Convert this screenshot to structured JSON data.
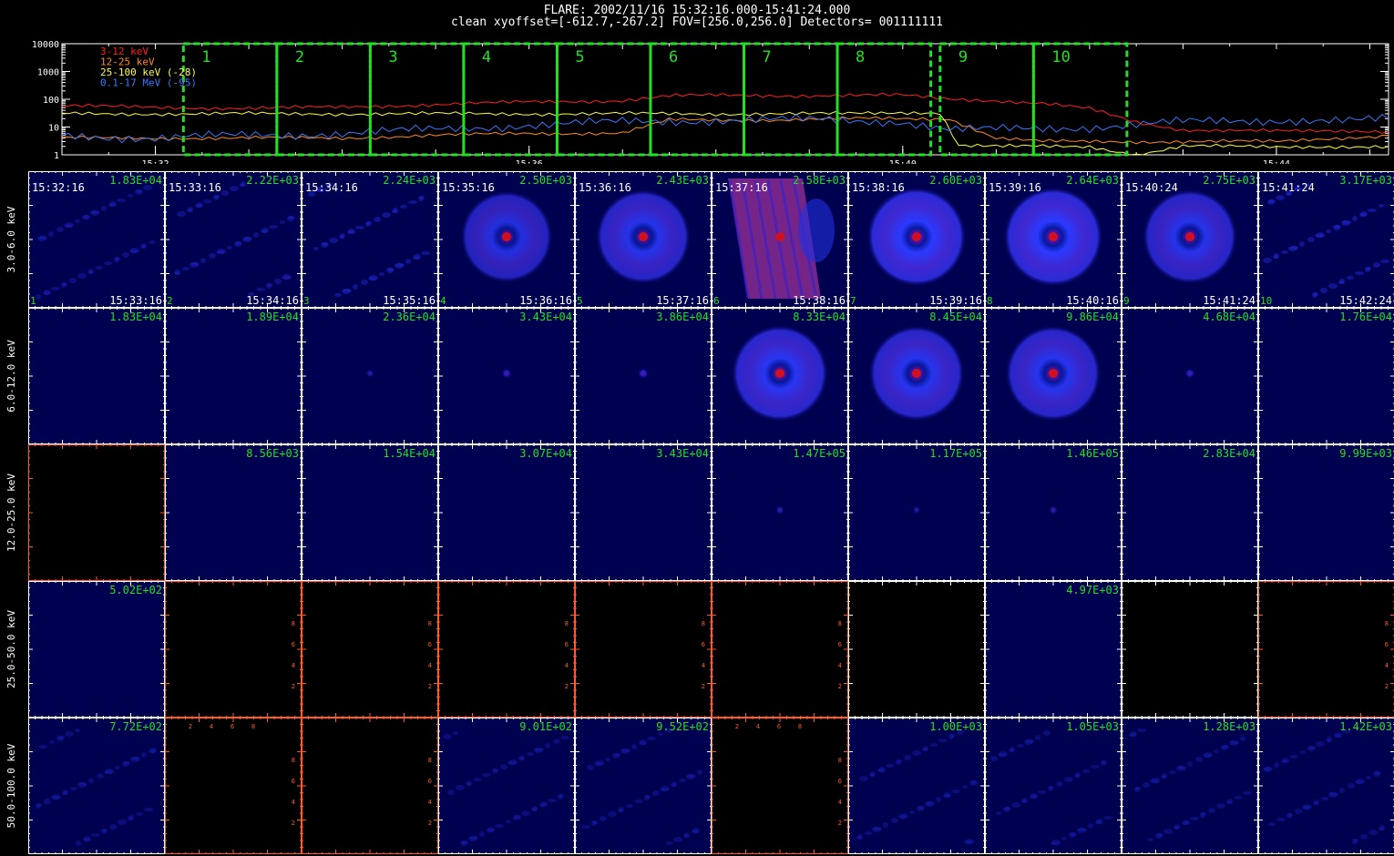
{
  "header": {
    "line1": "FLARE: 2002/11/16 15:32:16.000-15:41:24.000",
    "line2": "clean   xyoffset=[-612.7,-267.2]   FOV=[256.0,256.0]   Detectors= 001111111"
  },
  "colors": {
    "band_3_12": "#ff2020",
    "band_12_25": "#ff8c1a",
    "band_25_100": "#ffff40",
    "band_01_17": "#3c78ff",
    "interval_box": "#22e022",
    "label_green": "#22e022",
    "empty_axis": "#ff5a28",
    "panel_border": "#ffffff"
  },
  "chart_data": [
    {
      "type": "line",
      "yscale": "log",
      "ylim": [
        1,
        10000
      ],
      "yticks": [
        "10000",
        "1000",
        "100",
        "10",
        "1"
      ],
      "xlim_minutes": [
        31.0,
        45.2
      ],
      "xticks": [
        {
          "label": "15:32",
          "minute": 32
        },
        {
          "label": "15:36",
          "minute": 36
        },
        {
          "label": "15:40",
          "minute": 40
        },
        {
          "label": "15:44",
          "minute": 44
        }
      ],
      "legend": [
        {
          "label": "3-12 keV",
          "color": "#ff2020"
        },
        {
          "label": "12-25 keV",
          "color": "#ff8c1a"
        },
        {
          "label": "25-100 keV (-28)",
          "color": "#ffff40"
        },
        {
          "label": "0.1-17 MeV (-95)",
          "color": "#3c78ff"
        }
      ],
      "series": [
        {
          "name": "3-12 keV",
          "color": "#ff2020",
          "minutes": [
            31.0,
            32.0,
            33.0,
            34.0,
            35.0,
            36.0,
            37.0,
            37.5,
            38.0,
            39.0,
            40.0,
            40.5,
            41.0,
            41.5,
            42.0,
            42.5,
            43.0,
            44.0,
            45.2
          ],
          "values": [
            60,
            50,
            48,
            52,
            65,
            80,
            90,
            130,
            140,
            135,
            140,
            105,
            90,
            70,
            45,
            15,
            8,
            7,
            7
          ]
        },
        {
          "name": "12-25 keV",
          "color": "#ff8c1a",
          "minutes": [
            31.0,
            32.5,
            34.0,
            35.0,
            36.0,
            37.0,
            37.5,
            38.5,
            39.5,
            40.5,
            41.0,
            41.5,
            42.0,
            43.0,
            44.0,
            45.2
          ],
          "values": [
            4,
            4,
            4,
            5,
            6,
            6,
            18,
            18,
            20,
            20,
            4,
            3,
            3,
            3,
            3,
            5
          ]
        },
        {
          "name": "25-100 keV (-28)",
          "color": "#ffff40",
          "minutes": [
            31.0,
            33.0,
            35.0,
            37.0,
            39.0,
            40.4,
            40.6,
            41.0,
            42.0,
            42.5,
            43.0,
            44.0,
            45.2
          ],
          "values": [
            30,
            30,
            30,
            30,
            30,
            30,
            2,
            2,
            2,
            1,
            2,
            2,
            2
          ]
        },
        {
          "name": "0.1-17 MeV (-95)",
          "color": "#3c78ff",
          "minutes": [
            31.0,
            32.0,
            33.0,
            34.0,
            35.0,
            36.0,
            37.0,
            38.0,
            39.0,
            40.0,
            40.5,
            41.0,
            42.0,
            43.0,
            44.0,
            45.2
          ],
          "values": [
            5,
            4,
            5,
            6,
            8,
            12,
            15,
            18,
            18,
            16,
            8,
            8,
            10,
            15,
            18,
            20
          ]
        }
      ],
      "intervals": [
        {
          "label": "1",
          "start": 32.3,
          "end": 33.3
        },
        {
          "label": "2",
          "start": 33.3,
          "end": 34.3
        },
        {
          "label": "3",
          "start": 34.3,
          "end": 35.3
        },
        {
          "label": "4",
          "start": 35.3,
          "end": 36.3
        },
        {
          "label": "5",
          "start": 36.3,
          "end": 37.3
        },
        {
          "label": "6",
          "start": 37.3,
          "end": 38.3
        },
        {
          "label": "7",
          "start": 38.3,
          "end": 39.3
        },
        {
          "label": "8",
          "start": 39.3,
          "end": 40.3
        },
        {
          "label": "9",
          "start": 40.4,
          "end": 41.4
        },
        {
          "label": "10",
          "start": 41.4,
          "end": 42.4
        }
      ]
    },
    {
      "type": "heatmap",
      "columns": [
        {
          "index": "1",
          "start": "15:32:16",
          "end": "15:33:16"
        },
        {
          "index": "2",
          "start": "15:33:16",
          "end": "15:34:16"
        },
        {
          "index": "3",
          "start": "15:34:16",
          "end": "15:35:16"
        },
        {
          "index": "4",
          "start": "15:35:16",
          "end": "15:36:16"
        },
        {
          "index": "5",
          "start": "15:36:16",
          "end": "15:37:16"
        },
        {
          "index": "6",
          "start": "15:37:16",
          "end": "15:38:16"
        },
        {
          "index": "7",
          "start": "15:38:16",
          "end": "15:39:16"
        },
        {
          "index": "8",
          "start": "15:39:16",
          "end": "15:40:16"
        },
        {
          "index": "9",
          "start": "15:40:24",
          "end": "15:41:24"
        },
        {
          "index": "10",
          "start": "15:41:24",
          "end": "15:42:24"
        }
      ],
      "empty_axis_ticks": [
        "2",
        "4",
        "6",
        "8"
      ],
      "rows": [
        {
          "label": "3.0-6.0 keV",
          "cells": [
            {
              "peak": "1.83E+04",
              "type": "noise",
              "level": 0.25
            },
            {
              "peak": "2.22E+03",
              "type": "noise",
              "level": 0.35
            },
            {
              "peak": "2.24E+03",
              "type": "noise",
              "level": 0.45
            },
            {
              "peak": "2.50E+03",
              "type": "disk",
              "level": 0.6
            },
            {
              "peak": "2.43E+03",
              "type": "disk",
              "level": 0.75
            },
            {
              "peak": "2.58E+03",
              "type": "streak",
              "level": 0.9
            },
            {
              "peak": "2.60E+03",
              "type": "disk",
              "level": 1.0
            },
            {
              "peak": "2.64E+03",
              "type": "disk",
              "level": 1.0
            },
            {
              "peak": "2.75E+03",
              "type": "disk",
              "level": 0.75
            },
            {
              "peak": "3.17E+03",
              "type": "noise",
              "level": 0.5
            }
          ]
        },
        {
          "label": "6.0-12.0 keV",
          "cells": [
            {
              "peak": "1.83E+04",
              "type": "plain",
              "level": 0
            },
            {
              "peak": "1.89E+04",
              "type": "plain",
              "level": 0
            },
            {
              "peak": "2.36E+04",
              "type": "dot",
              "level": 0.2
            },
            {
              "peak": "3.43E+04",
              "type": "dot",
              "level": 0.5
            },
            {
              "peak": "3.86E+04",
              "type": "dot",
              "level": 0.6
            },
            {
              "peak": "8.33E+04",
              "type": "disk",
              "level": 0.85
            },
            {
              "peak": "8.45E+04",
              "type": "disk",
              "level": 0.8
            },
            {
              "peak": "9.86E+04",
              "type": "disk",
              "level": 0.8
            },
            {
              "peak": "4.68E+04",
              "type": "dot",
              "level": 0.5
            },
            {
              "peak": "1.76E+04",
              "type": "plain",
              "level": 0
            }
          ]
        },
        {
          "label": "12.0-25.0 keV",
          "cells": [
            {
              "peak": "",
              "type": "empty",
              "level": 0
            },
            {
              "peak": "8.56E+03",
              "type": "plain",
              "level": 0
            },
            {
              "peak": "1.54E+04",
              "type": "plain",
              "level": 0
            },
            {
              "peak": "3.07E+04",
              "type": "plain",
              "level": 0
            },
            {
              "peak": "3.43E+04",
              "type": "plain",
              "level": 0
            },
            {
              "peak": "1.47E+05",
              "type": "dot",
              "level": 0.3
            },
            {
              "peak": "1.17E+05",
              "type": "dot",
              "level": 0.15
            },
            {
              "peak": "1.46E+05",
              "type": "dot",
              "level": 0.3
            },
            {
              "peak": "2.83E+04",
              "type": "plain",
              "level": 0
            },
            {
              "peak": "9.99E+03",
              "type": "plain",
              "level": 0
            }
          ]
        },
        {
          "label": "25.0-50.0 keV",
          "cells": [
            {
              "peak": "5.02E+02",
              "type": "plain",
              "level": 0
            },
            {
              "peak": "",
              "type": "emptyaxis",
              "level": 0
            },
            {
              "peak": "",
              "type": "emptyaxis",
              "level": 0
            },
            {
              "peak": "",
              "type": "emptyaxis",
              "level": 0
            },
            {
              "peak": "",
              "type": "emptyaxis",
              "level": 0
            },
            {
              "peak": "",
              "type": "emptyaxis",
              "level": 0
            },
            {
              "peak": "",
              "type": "empty",
              "level": 0
            },
            {
              "peak": "4.97E+03",
              "type": "plain",
              "level": 0
            },
            {
              "peak": "",
              "type": "empty",
              "level": 0
            },
            {
              "peak": "",
              "type": "emptyaxis",
              "level": 0
            }
          ]
        },
        {
          "label": "50.0-100.0 keV",
          "cells": [
            {
              "peak": "7.72E+02",
              "type": "noise",
              "level": 0.15
            },
            {
              "peak": "",
              "type": "emptyaxisx",
              "level": 0
            },
            {
              "peak": "",
              "type": "emptyaxis",
              "level": 0
            },
            {
              "peak": "9.01E+02",
              "type": "noise",
              "level": 0.15
            },
            {
              "peak": "9.52E+02",
              "type": "noise",
              "level": 0.15
            },
            {
              "peak": "",
              "type": "emptyaxisx",
              "level": 0
            },
            {
              "peak": "1.00E+03",
              "type": "noise",
              "level": 0.15
            },
            {
              "peak": "1.05E+03",
              "type": "noise",
              "level": 0.15
            },
            {
              "peak": "1.28E+03",
              "type": "noise",
              "level": 0.15
            },
            {
              "peak": "1.42E+03",
              "type": "noise",
              "level": 0.15
            }
          ]
        }
      ]
    }
  ]
}
